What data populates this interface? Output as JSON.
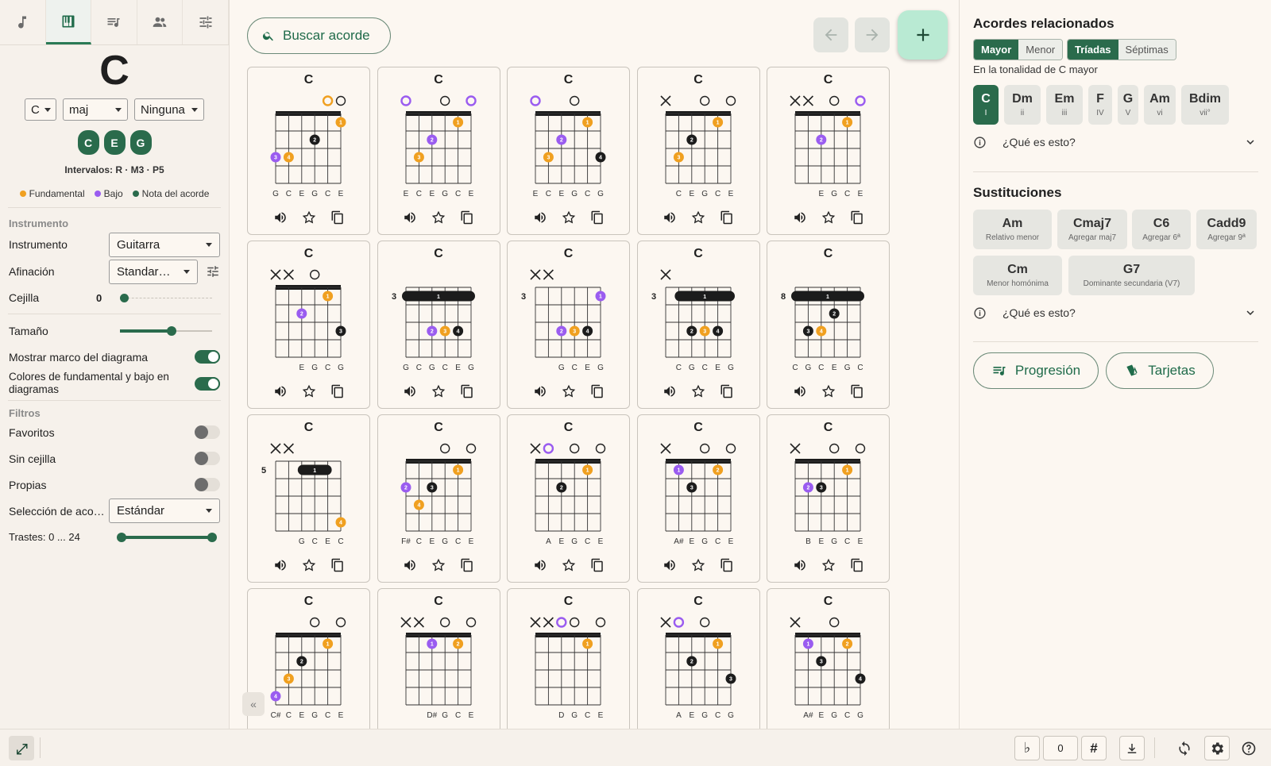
{
  "left_tabs": [
    {
      "name": "notes-icon"
    },
    {
      "name": "piano-icon"
    },
    {
      "name": "playlist-icon"
    },
    {
      "name": "people-icon"
    },
    {
      "name": "sliders-icon"
    }
  ],
  "chord": {
    "name": "C",
    "root": "C",
    "quality": "maj",
    "bass": "Ninguna",
    "notes": [
      "C",
      "E",
      "G"
    ],
    "intervals": "Intervalos: R · M3 · P5"
  },
  "legend": {
    "root": "Fundamental",
    "bass": "Bajo",
    "note": "Nota del acorde"
  },
  "colors": {
    "root": "#f0a020",
    "bass": "#9a5cf0",
    "note": "#1c1c1c",
    "accent": "#2a6b4c"
  },
  "settings": {
    "section_instrument": "Instrumento",
    "instrument_label": "Instrumento",
    "instrument_value": "Guitarra",
    "tuning_label": "Afinación",
    "tuning_value": "Standar…",
    "capo_label": "Cejilla",
    "capo_value": "0",
    "size_label": "Tamaño",
    "size_level": 0.55,
    "frame_label": "Mostrar marco del diagrama",
    "colors_label": "Colores de fundamental y bajo en diagramas",
    "section_filters": "Filtros",
    "favorites_label": "Favoritos",
    "nobarre_label": "Sin cejilla",
    "own_label": "Propias",
    "selection_label": "Selección de aco…",
    "selection_value": "Estándar",
    "frets_label": "Trastes: 0 ... 24"
  },
  "search": {
    "label": "Buscar acorde"
  },
  "chord_cards": [
    {
      "name": "C",
      "top": [
        "",
        "",
        "",
        "",
        "r",
        "o"
      ],
      "fret": "",
      "barre": null,
      "dots": [
        [
          5,
          1,
          "r",
          "1"
        ],
        [
          3,
          2,
          "n",
          "2"
        ],
        [
          1,
          3,
          "r",
          "4"
        ],
        [
          0,
          3,
          "b",
          "3"
        ]
      ],
      "labels": [
        "G",
        "C",
        "E",
        "G",
        "C",
        "E"
      ]
    },
    {
      "name": "C",
      "top": [
        "b",
        "",
        "",
        "o",
        "",
        "b"
      ],
      "fret": "",
      "barre": null,
      "dots": [
        [
          4,
          1,
          "r",
          "1"
        ],
        [
          2,
          2,
          "b",
          "2"
        ],
        [
          1,
          3,
          "r",
          "3"
        ]
      ],
      "labels": [
        "E",
        "C",
        "E",
        "G",
        "C",
        "E"
      ]
    },
    {
      "name": "C",
      "top": [
        "b",
        "",
        "",
        "o",
        "",
        ""
      ],
      "fret": "",
      "barre": null,
      "dots": [
        [
          4,
          1,
          "r",
          "1"
        ],
        [
          2,
          2,
          "b",
          "2"
        ],
        [
          1,
          3,
          "r",
          "3"
        ],
        [
          5,
          3,
          "n",
          "4"
        ]
      ],
      "labels": [
        "E",
        "C",
        "E",
        "G",
        "C",
        "G"
      ]
    },
    {
      "name": "C",
      "top": [
        "x",
        "",
        "",
        "o",
        "",
        "o"
      ],
      "fret": "",
      "barre": null,
      "dots": [
        [
          4,
          1,
          "r",
          "1"
        ],
        [
          2,
          2,
          "n",
          "2"
        ],
        [
          1,
          3,
          "r",
          "3"
        ]
      ],
      "labels": [
        "",
        "C",
        "E",
        "G",
        "C",
        "E"
      ]
    },
    {
      "name": "C",
      "top": [
        "x",
        "x",
        "",
        "o",
        "",
        "b"
      ],
      "fret": "",
      "barre": null,
      "dots": [
        [
          4,
          1,
          "r",
          "1"
        ],
        [
          2,
          2,
          "b",
          "2"
        ]
      ],
      "labels": [
        "",
        "",
        "E",
        "G",
        "C",
        "E"
      ]
    },
    {
      "name": "C",
      "top": [
        "x",
        "x",
        "",
        "o",
        "",
        ""
      ],
      "fret": "",
      "barre": null,
      "dots": [
        [
          4,
          1,
          "r",
          "1"
        ],
        [
          2,
          2,
          "b",
          "2"
        ],
        [
          5,
          3,
          "n",
          "3"
        ]
      ],
      "labels": [
        "",
        "",
        "E",
        "G",
        "C",
        "G"
      ]
    },
    {
      "name": "C",
      "top": [
        "",
        "",
        "",
        "",
        "",
        ""
      ],
      "fret": "3",
      "barre": [
        0,
        5
      ],
      "dots": [
        [
          2,
          3,
          "b",
          "2"
        ],
        [
          3,
          3,
          "r",
          "3"
        ],
        [
          4,
          3,
          "n",
          "4"
        ]
      ],
      "labels": [
        "G",
        "C",
        "G",
        "C",
        "E",
        "G"
      ]
    },
    {
      "name": "C",
      "top": [
        "x",
        "x",
        "",
        "",
        "",
        ""
      ],
      "fret": "3",
      "barre": null,
      "dots": [
        [
          5,
          1,
          "b",
          "1"
        ],
        [
          2,
          3,
          "b",
          "2"
        ],
        [
          3,
          3,
          "r",
          "3"
        ],
        [
          4,
          3,
          "n",
          "4"
        ]
      ],
      "labels": [
        "",
        "",
        "G",
        "C",
        "E",
        "G"
      ]
    },
    {
      "name": "C",
      "top": [
        "x",
        "",
        "",
        "",
        "",
        ""
      ],
      "fret": "3",
      "barre": [
        1,
        5
      ],
      "dots": [
        [
          2,
          3,
          "n",
          "2"
        ],
        [
          3,
          3,
          "r",
          "3"
        ],
        [
          4,
          3,
          "n",
          "4"
        ]
      ],
      "labels": [
        "",
        "C",
        "G",
        "C",
        "E",
        "G"
      ]
    },
    {
      "name": "C",
      "top": [
        "",
        "",
        "",
        "",
        "",
        ""
      ],
      "fret": "8",
      "barre": [
        0,
        5
      ],
      "dots": [
        [
          3,
          2,
          "n",
          "2"
        ],
        [
          1,
          3,
          "n",
          "3"
        ],
        [
          2,
          3,
          "r",
          "4"
        ]
      ],
      "labels": [
        "C",
        "G",
        "C",
        "E",
        "G",
        "C"
      ]
    },
    {
      "name": "C",
      "top": [
        "x",
        "x",
        "",
        "",
        "",
        ""
      ],
      "fret": "5",
      "barre": [
        2,
        4
      ],
      "dots": [
        [
          5,
          4,
          "r",
          "4"
        ]
      ],
      "labels": [
        "",
        "",
        "G",
        "C",
        "E",
        "C"
      ]
    },
    {
      "name": "C",
      "top": [
        "",
        "",
        "",
        "o",
        "",
        "o"
      ],
      "fret": "",
      "barre": null,
      "dots": [
        [
          4,
          1,
          "r",
          "1"
        ],
        [
          0,
          2,
          "b",
          "2"
        ],
        [
          2,
          2,
          "n",
          "3"
        ],
        [
          1,
          3,
          "r",
          "4"
        ]
      ],
      "labels": [
        "F#",
        "C",
        "E",
        "G",
        "C",
        "E"
      ]
    },
    {
      "name": "C",
      "top": [
        "x",
        "b",
        "",
        "o",
        "",
        "o"
      ],
      "fret": "",
      "barre": null,
      "dots": [
        [
          4,
          1,
          "r",
          "1"
        ],
        [
          2,
          2,
          "n",
          "2"
        ]
      ],
      "labels": [
        "",
        "A",
        "E",
        "G",
        "C",
        "E"
      ]
    },
    {
      "name": "C",
      "top": [
        "x",
        "",
        "",
        "o",
        "",
        "o"
      ],
      "fret": "",
      "barre": null,
      "dots": [
        [
          1,
          1,
          "b",
          "1"
        ],
        [
          4,
          1,
          "r",
          "2"
        ],
        [
          2,
          2,
          "n",
          "3"
        ]
      ],
      "labels": [
        "",
        "A#",
        "E",
        "G",
        "C",
        "E"
      ]
    },
    {
      "name": "C",
      "top": [
        "x",
        "",
        "",
        "o",
        "",
        "o"
      ],
      "fret": "",
      "barre": null,
      "dots": [
        [
          4,
          1,
          "r",
          "1"
        ],
        [
          1,
          2,
          "b",
          "2"
        ],
        [
          2,
          2,
          "n",
          "3"
        ]
      ],
      "labels": [
        "",
        "B",
        "E",
        "G",
        "C",
        "E"
      ]
    },
    {
      "name": "C",
      "top": [
        "",
        "",
        "",
        "o",
        "",
        "o"
      ],
      "fret": "",
      "barre": null,
      "dots": [
        [
          4,
          1,
          "r",
          "1"
        ],
        [
          2,
          2,
          "n",
          "2"
        ],
        [
          1,
          3,
          "r",
          "3"
        ],
        [
          0,
          4,
          "b",
          "4"
        ]
      ],
      "labels": [
        "C#",
        "C",
        "E",
        "G",
        "C",
        "E"
      ]
    },
    {
      "name": "C",
      "top": [
        "x",
        "x",
        "",
        "o",
        "",
        "o"
      ],
      "fret": "",
      "barre": null,
      "dots": [
        [
          2,
          1,
          "b",
          "1"
        ],
        [
          4,
          1,
          "r",
          "2"
        ]
      ],
      "labels": [
        "",
        "",
        "D#",
        "G",
        "C",
        "E"
      ]
    },
    {
      "name": "C",
      "top": [
        "x",
        "x",
        "b",
        "o",
        "",
        "o"
      ],
      "fret": "",
      "barre": null,
      "dots": [
        [
          4,
          1,
          "r",
          "1"
        ]
      ],
      "labels": [
        "",
        "",
        "D",
        "G",
        "C",
        "E"
      ]
    },
    {
      "name": "C",
      "top": [
        "x",
        "b",
        "",
        "o",
        "",
        ""
      ],
      "fret": "",
      "barre": null,
      "dots": [
        [
          4,
          1,
          "r",
          "1"
        ],
        [
          2,
          2,
          "n",
          "2"
        ],
        [
          5,
          3,
          "n",
          "3"
        ]
      ],
      "labels": [
        "",
        "A",
        "E",
        "G",
        "C",
        "G"
      ]
    },
    {
      "name": "C",
      "top": [
        "x",
        "",
        "",
        "o",
        "",
        ""
      ],
      "fret": "",
      "barre": null,
      "dots": [
        [
          1,
          1,
          "b",
          "1"
        ],
        [
          4,
          1,
          "r",
          "2"
        ],
        [
          2,
          2,
          "n",
          "3"
        ],
        [
          5,
          3,
          "n",
          "4"
        ]
      ],
      "labels": [
        "",
        "A#",
        "E",
        "G",
        "C",
        "G"
      ]
    }
  ],
  "related": {
    "title": "Acordes relacionados",
    "seg1": [
      "Mayor",
      "Menor"
    ],
    "seg2": [
      "Tríadas",
      "Séptimas"
    ],
    "subtitle": "En la tonalidad de C mayor",
    "chords": [
      {
        "t": "C",
        "s": "I"
      },
      {
        "t": "Dm",
        "s": "ii"
      },
      {
        "t": "Em",
        "s": "iii"
      },
      {
        "t": "F",
        "s": "IV"
      },
      {
        "t": "G",
        "s": "V"
      },
      {
        "t": "Am",
        "s": "vi"
      },
      {
        "t": "Bdim",
        "s": "vii°"
      }
    ],
    "what": "¿Qué es esto?"
  },
  "subs": {
    "title": "Sustituciones",
    "items": [
      {
        "t": "Am",
        "s": "Relativo menor"
      },
      {
        "t": "Cmaj7",
        "s": "Agregar maj7"
      },
      {
        "t": "C6",
        "s": "Agregar 6ª"
      },
      {
        "t": "Cadd9",
        "s": "Agregar 9ª"
      },
      {
        "t": "Cm",
        "s": "Menor homónima"
      },
      {
        "t": "G7",
        "s": "Dominante secundaria (V7)"
      }
    ],
    "what": "¿Qué es esto?"
  },
  "buttons": {
    "progression": "Progresión",
    "cards": "Tarjetas"
  },
  "bottom": {
    "flat": "♭",
    "transpose": "0",
    "sharp": "#"
  }
}
